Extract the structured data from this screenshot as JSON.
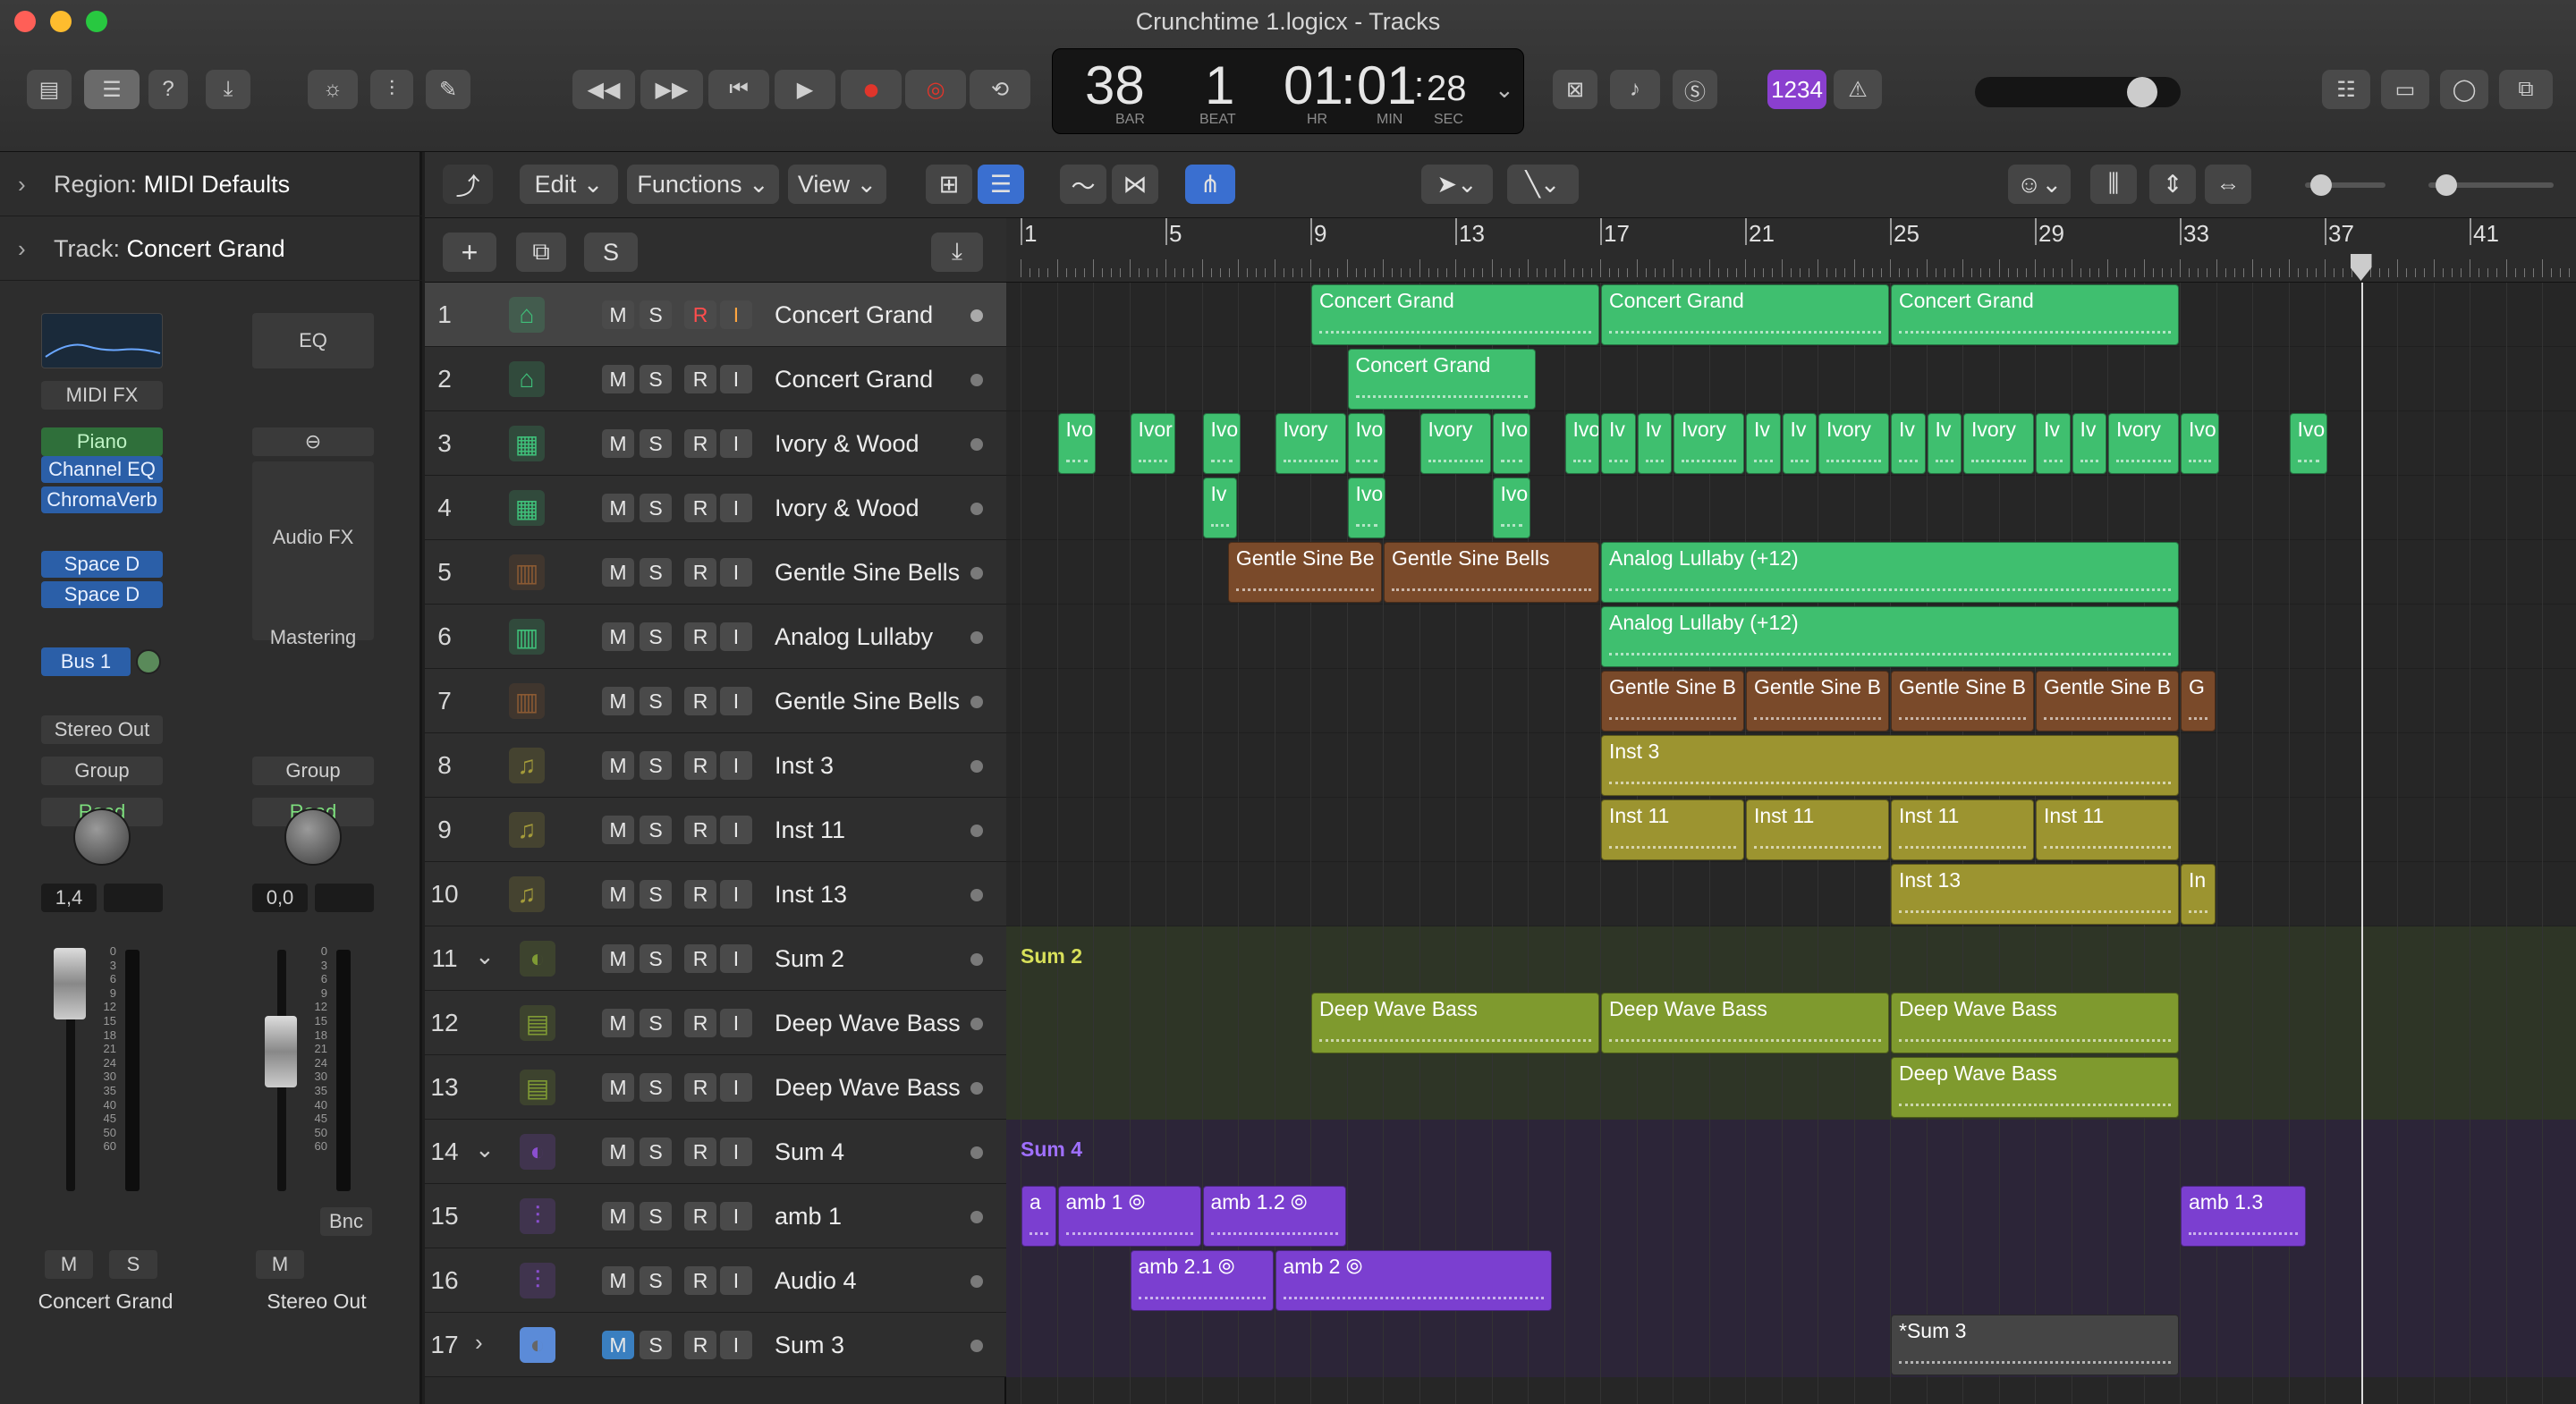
{
  "window": {
    "title": "Crunchtime 1.logicx - Tracks"
  },
  "lcd": {
    "bar": "38",
    "beat": "1",
    "hr": "01",
    "min": "01",
    "sec": "28",
    "lbl_bar": "BAR",
    "lbl_beat": "BEAT",
    "lbl_hr": "HR",
    "lbl_min": "MIN",
    "lbl_sec": "SEC"
  },
  "count_in": "1234",
  "inspector": {
    "region_label": "Region:",
    "region_value": "MIDI Defaults",
    "track_label": "Track:",
    "track_value": "Concert Grand",
    "left_strip": {
      "midi_fx": "MIDI FX",
      "instrument": "Piano",
      "plugins": [
        "Channel EQ",
        "ChromaVerb"
      ],
      "sends": [
        "Space D",
        "Space D"
      ],
      "bus": "Bus 1",
      "output": "Stereo Out",
      "group": "Group",
      "automation": "Read",
      "pan": "1,4",
      "mute": "M",
      "solo": "S",
      "name": "Concert Grand"
    },
    "right_strip": {
      "eq": "EQ",
      "audio_fx": "Audio FX",
      "mastering": "Mastering",
      "group": "Group",
      "automation": "Read",
      "pan": "0,0",
      "mute": "M",
      "bnc": "Bnc",
      "name": "Stereo Out"
    },
    "scale": [
      "0",
      "3",
      "6",
      "9",
      "12",
      "15",
      "18",
      "21",
      "24",
      "30",
      "35",
      "40",
      "45",
      "50",
      "60"
    ]
  },
  "toolbar": {
    "edit": "Edit",
    "functions": "Functions",
    "view": "View"
  },
  "header": {
    "add": "+",
    "dup": "⧉",
    "solo": "S"
  },
  "ruler": [
    "1",
    "5",
    "9",
    "13",
    "17",
    "21",
    "25",
    "29",
    "33",
    "37",
    "41"
  ],
  "tracks": [
    {
      "num": "1",
      "name": "Concert Grand",
      "icon": "piano-icon",
      "color": "#3fc07a"
    },
    {
      "num": "2",
      "name": "Concert Grand",
      "icon": "piano-icon",
      "color": "#3fc07a"
    },
    {
      "num": "3",
      "name": "Ivory & Wood",
      "icon": "keyboard-icon",
      "color": "#3fc07a"
    },
    {
      "num": "4",
      "name": "Ivory & Wood",
      "icon": "keyboard-icon",
      "color": "#3fc07a"
    },
    {
      "num": "5",
      "name": "Gentle Sine Bells",
      "icon": "synth-icon",
      "color": "#8b5a33"
    },
    {
      "num": "6",
      "name": "Analog Lullaby",
      "icon": "synth-icon",
      "color": "#3fc07a"
    },
    {
      "num": "7",
      "name": "Gentle Sine Bells",
      "icon": "synth-icon",
      "color": "#8b5a33"
    },
    {
      "num": "8",
      "name": "Inst 3",
      "icon": "note-icon",
      "color": "#a39a3a"
    },
    {
      "num": "9",
      "name": "Inst 11",
      "icon": "note-icon",
      "color": "#a39a3a"
    },
    {
      "num": "10",
      "name": "Inst 13",
      "icon": "note-icon",
      "color": "#a39a3a"
    },
    {
      "num": "11",
      "name": "Sum 2",
      "icon": "summing-icon",
      "color": "#7f9a34"
    },
    {
      "num": "12",
      "name": "Deep Wave Bass",
      "icon": "bass-synth-icon",
      "color": "#7f9a34"
    },
    {
      "num": "13",
      "name": "Deep Wave Bass",
      "icon": "bass-synth-icon",
      "color": "#7f9a34"
    },
    {
      "num": "14",
      "name": "Sum 4",
      "icon": "summing-icon",
      "color": "#8b4fd0"
    },
    {
      "num": "15",
      "name": "amb 1",
      "icon": "waveform-icon",
      "color": "#8b4fd0"
    },
    {
      "num": "16",
      "name": "Audio 4",
      "icon": "waveform-icon",
      "color": "#8b4fd0"
    },
    {
      "num": "17",
      "name": "Sum 3",
      "icon": "summing-icon",
      "color": "#666666"
    }
  ],
  "btn": {
    "m": "M",
    "s": "S",
    "r": "R",
    "i": "I"
  },
  "regions": [
    {
      "lane": 0,
      "start": 9,
      "len": 8,
      "label": "Concert Grand",
      "color": "#3fbf6f"
    },
    {
      "lane": 0,
      "start": 17,
      "len": 8,
      "label": "Concert Grand",
      "color": "#3fbf6f"
    },
    {
      "lane": 0,
      "start": 25,
      "len": 8,
      "label": "Concert Grand",
      "color": "#3fbf6f"
    },
    {
      "lane": 1,
      "start": 10,
      "len": 5.25,
      "label": "Concert Grand",
      "color": "#3fbf6f"
    },
    {
      "lane": 2,
      "start": 2,
      "len": 1.1,
      "label": "Ivo",
      "color": "#3fbf6f"
    },
    {
      "lane": 2,
      "start": 4,
      "len": 1.3,
      "label": "Ivor",
      "color": "#3fbf6f"
    },
    {
      "lane": 2,
      "start": 6,
      "len": 1.1,
      "label": "Ivo",
      "color": "#3fbf6f"
    },
    {
      "lane": 2,
      "start": 8,
      "len": 2,
      "label": "Ivory",
      "color": "#3fbf6f"
    },
    {
      "lane": 2,
      "start": 10,
      "len": 1.1,
      "label": "Ivo",
      "color": "#3fbf6f"
    },
    {
      "lane": 2,
      "start": 12,
      "len": 2,
      "label": "Ivory",
      "color": "#3fbf6f"
    },
    {
      "lane": 2,
      "start": 14,
      "len": 1.1,
      "label": "Ivo",
      "color": "#3fbf6f"
    },
    {
      "lane": 2,
      "start": 16,
      "len": 1,
      "label": "Ivory",
      "color": "#3fbf6f"
    },
    {
      "lane": 2,
      "start": 17,
      "len": 1,
      "label": "Iv",
      "color": "#3fbf6f"
    },
    {
      "lane": 2,
      "start": 18,
      "len": 1,
      "label": "Iv",
      "color": "#3fbf6f"
    },
    {
      "lane": 2,
      "start": 19,
      "len": 2,
      "label": "Ivory",
      "color": "#3fbf6f"
    },
    {
      "lane": 2,
      "start": 21,
      "len": 1,
      "label": "Iv",
      "color": "#3fbf6f"
    },
    {
      "lane": 2,
      "start": 22,
      "len": 1,
      "label": "Iv",
      "color": "#3fbf6f"
    },
    {
      "lane": 2,
      "start": 23,
      "len": 2,
      "label": "Ivory",
      "color": "#3fbf6f"
    },
    {
      "lane": 2,
      "start": 25,
      "len": 1,
      "label": "Iv",
      "color": "#3fbf6f"
    },
    {
      "lane": 2,
      "start": 26,
      "len": 1,
      "label": "Iv",
      "color": "#3fbf6f"
    },
    {
      "lane": 2,
      "start": 27,
      "len": 2,
      "label": "Ivory",
      "color": "#3fbf6f"
    },
    {
      "lane": 2,
      "start": 29,
      "len": 1,
      "label": "Iv",
      "color": "#3fbf6f"
    },
    {
      "lane": 2,
      "start": 30,
      "len": 1,
      "label": "Iv",
      "color": "#3fbf6f"
    },
    {
      "lane": 2,
      "start": 31,
      "len": 2,
      "label": "Ivory",
      "color": "#3fbf6f"
    },
    {
      "lane": 2,
      "start": 33,
      "len": 1.1,
      "label": "Ivo",
      "color": "#3fbf6f"
    },
    {
      "lane": 2,
      "start": 36,
      "len": 1.1,
      "label": "Ivo",
      "color": "#3fbf6f"
    },
    {
      "lane": 3,
      "start": 6,
      "len": 1,
      "label": "Iv",
      "color": "#3fbf6f"
    },
    {
      "lane": 3,
      "start": 10,
      "len": 1.1,
      "label": "Ivo",
      "color": "#3fbf6f"
    },
    {
      "lane": 3,
      "start": 14,
      "len": 1.1,
      "label": "Ivo",
      "color": "#3fbf6f"
    },
    {
      "lane": 4,
      "start": 6.7,
      "len": 4.3,
      "label": "Gentle Sine Be",
      "color": "#7a4a2a"
    },
    {
      "lane": 4,
      "start": 11,
      "len": 6,
      "label": "Gentle Sine Bells",
      "color": "#7a4a2a"
    },
    {
      "lane": 4,
      "start": 17,
      "len": 16,
      "label": "Analog Lullaby (+12)",
      "color": "#3fbf6f"
    },
    {
      "lane": 5,
      "start": 17,
      "len": 16,
      "label": "Analog Lullaby (+12)",
      "color": "#3fbf6f"
    },
    {
      "lane": 6,
      "start": 17,
      "len": 4,
      "label": "Gentle Sine B",
      "color": "#7a4a2a"
    },
    {
      "lane": 6,
      "start": 21,
      "len": 4,
      "label": "Gentle Sine B",
      "color": "#7a4a2a"
    },
    {
      "lane": 6,
      "start": 25,
      "len": 4,
      "label": "Gentle Sine B",
      "color": "#7a4a2a"
    },
    {
      "lane": 6,
      "start": 29,
      "len": 4,
      "label": "Gentle Sine B",
      "color": "#7a4a2a"
    },
    {
      "lane": 6,
      "start": 33,
      "len": 1,
      "label": "G",
      "color": "#7a4a2a"
    },
    {
      "lane": 7,
      "start": 17,
      "len": 16,
      "label": "Inst 3",
      "color": "#9c9430"
    },
    {
      "lane": 8,
      "start": 17,
      "len": 4,
      "label": "Inst 11",
      "color": "#9c9430"
    },
    {
      "lane": 8,
      "start": 21,
      "len": 4,
      "label": "Inst 11",
      "color": "#9c9430"
    },
    {
      "lane": 8,
      "start": 25,
      "len": 4,
      "label": "Inst 11",
      "color": "#9c9430"
    },
    {
      "lane": 8,
      "start": 29,
      "len": 4,
      "label": "Inst 11",
      "color": "#9c9430"
    },
    {
      "lane": 9,
      "start": 25,
      "len": 8,
      "label": "Inst 13",
      "color": "#9c9430"
    },
    {
      "lane": 9,
      "start": 33,
      "len": 1,
      "label": "In",
      "color": "#9c9430"
    },
    {
      "lane": 11,
      "start": 9,
      "len": 8,
      "label": "Deep Wave Bass",
      "color": "#7f9a2e"
    },
    {
      "lane": 11,
      "start": 17,
      "len": 8,
      "label": "Deep Wave Bass",
      "color": "#7f9a2e"
    },
    {
      "lane": 11,
      "start": 25,
      "len": 8,
      "label": "Deep Wave Bass",
      "color": "#7f9a2e"
    },
    {
      "lane": 12,
      "start": 25,
      "len": 8,
      "label": "Deep Wave Bass",
      "color": "#7f9a2e"
    },
    {
      "lane": 14,
      "start": 1,
      "len": 1,
      "label": "a",
      "color": "#7b3fd0"
    },
    {
      "lane": 14,
      "start": 2,
      "len": 4,
      "label": "amb 1 ⦾",
      "color": "#7b3fd0"
    },
    {
      "lane": 14,
      "start": 6,
      "len": 4,
      "label": "amb 1.2 ⦾",
      "color": "#7b3fd0"
    },
    {
      "lane": 14,
      "start": 33,
      "len": 3.5,
      "label": "amb 1.3",
      "color": "#7b3fd0"
    },
    {
      "lane": 15,
      "start": 4,
      "len": 4,
      "label": "amb 2.1 ⦾",
      "color": "#7b3fd0"
    },
    {
      "lane": 15,
      "start": 8,
      "len": 7.7,
      "label": "amb 2 ⦾",
      "color": "#7b3fd0"
    },
    {
      "lane": 16,
      "start": 25,
      "len": 8,
      "label": "*Sum 3",
      "color": "#454545"
    }
  ],
  "folders": [
    {
      "lane": 10,
      "label": "Sum 2",
      "color": "#2e3526",
      "text": "#d8e05a"
    },
    {
      "lane": 13,
      "label": "Sum 4",
      "color": "#2c2538",
      "text": "#a070ff"
    }
  ]
}
